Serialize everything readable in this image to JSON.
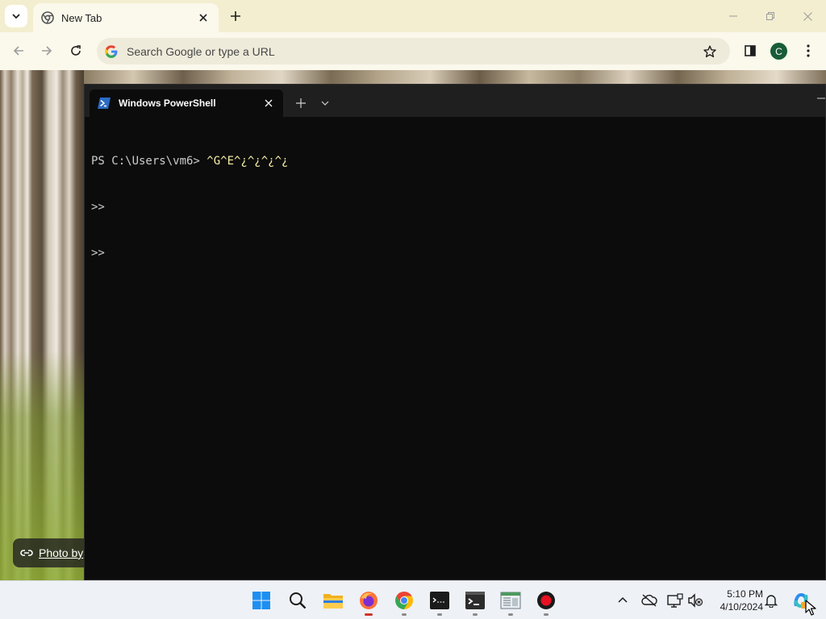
{
  "browser": {
    "tabs": [
      {
        "title": "New Tab"
      }
    ],
    "omnibox": {
      "placeholder": "Search Google or type a URL"
    },
    "profile_initial": "C"
  },
  "new_tab_page": {
    "photo_credit": "Photo by"
  },
  "terminal": {
    "tab_title": "Windows PowerShell",
    "prompt": "PS C:\\Users\\vm6> ",
    "command": "^G^E^¿^¿^¿^¿",
    "continuation_lines": [
      ">>",
      ">>"
    ]
  },
  "taskbar": {
    "pinned": [
      {
        "name": "start-icon"
      },
      {
        "name": "search-icon"
      },
      {
        "name": "file-explorer-icon"
      },
      {
        "name": "firefox-icon"
      },
      {
        "name": "chrome-icon"
      },
      {
        "name": "terminal-app-icon"
      },
      {
        "name": "powershell-app-icon"
      },
      {
        "name": "notepad-icon"
      },
      {
        "name": "record-icon"
      }
    ],
    "clock": {
      "time": "5:10 PM",
      "date": "4/10/2024"
    }
  },
  "colors": {
    "tabstrip": "#f3eecf",
    "toolbar": "#fbf8ec",
    "terminal_bg": "#0c0c0c",
    "terminal_command": "#f9f1a5",
    "taskbar": "#eef1f6"
  }
}
